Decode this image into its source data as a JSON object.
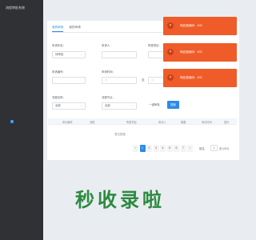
{
  "sidebar": {
    "title": "流程审批系统"
  },
  "tabs": [
    {
      "label": "我的审批"
    },
    {
      "label": "我的申请"
    }
  ],
  "filters": {
    "row1": [
      {
        "label": "申请状态：",
        "value": "待审批"
      },
      {
        "label": "申请人：",
        "value": ""
      },
      {
        "label": "所属项目：",
        "value": ""
      }
    ],
    "row2": [
      {
        "label": "申请编号：",
        "value": ""
      },
      {
        "label": "申请时间：",
        "value": "",
        "separator": "至"
      }
    ],
    "row3": [
      {
        "label": "流程名称：",
        "value": "全部"
      },
      {
        "label": "流程节点：",
        "value": "全部"
      }
    ]
  },
  "buttons": {
    "batch": "一键审批",
    "search": "搜索"
  },
  "table": {
    "columns": [
      "申请编号",
      "流程",
      "所属项目",
      "申请人",
      "摘要",
      "申请时间",
      "操作"
    ],
    "empty_text": "暂无数据"
  },
  "pagination": {
    "prev": "‹",
    "pages": [
      "1",
      "2",
      "3",
      "4",
      "5",
      "6",
      "7"
    ],
    "current": "1",
    "next": "›",
    "goto_label": "前往",
    "goto_value": "1",
    "goto_suffix": "页 (GO)"
  },
  "toasts": [
    {
      "icon": "×",
      "text": "响应错误码：403"
    },
    {
      "icon": "×",
      "text": "响应错误码：403"
    },
    {
      "icon": "×",
      "text": "响应错误码：403"
    }
  ],
  "brand": {
    "text": "秒收录啦"
  },
  "colors": {
    "accent": "#2c8be8",
    "toast": "#ef5c2a",
    "sidebar": "#2f3135",
    "brand": "#2b8a3e"
  }
}
